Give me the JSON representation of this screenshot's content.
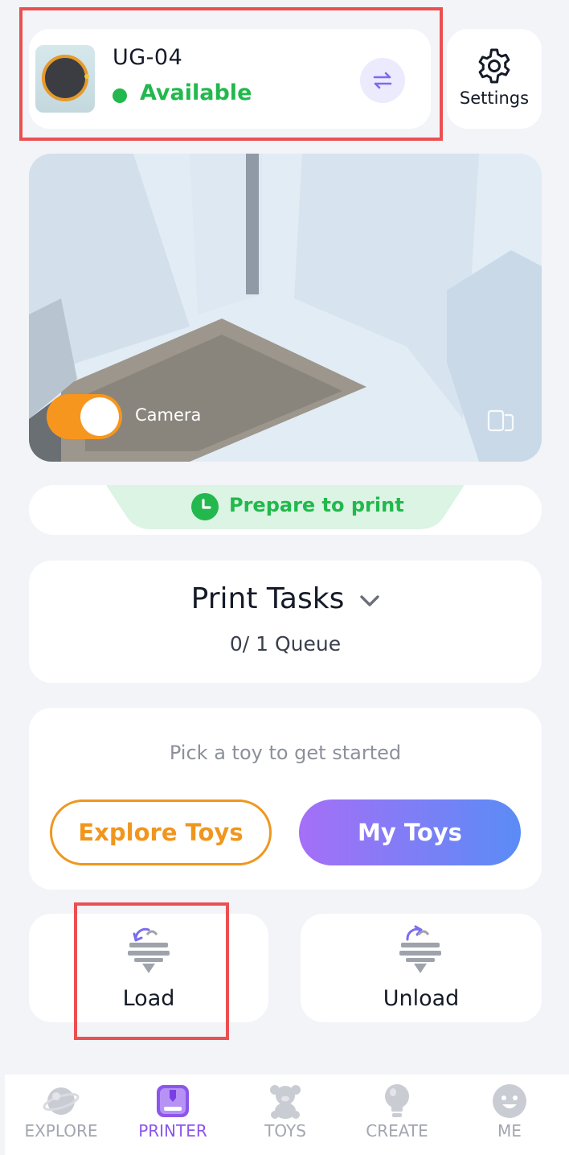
{
  "device": {
    "name": "UG-04",
    "status": "Available",
    "status_color": "#22b84d"
  },
  "settings": {
    "label": "Settings"
  },
  "camera": {
    "label": "Camera",
    "enabled": true,
    "toggle_color": "#f7961e"
  },
  "print_status": {
    "text": "Prepare to print"
  },
  "print_tasks": {
    "title": "Print Tasks",
    "queue": "0/ 1 Queue"
  },
  "toy_picker": {
    "prompt": "Pick a toy to get started",
    "explore_label": "Explore Toys",
    "mytoys_label": "My Toys"
  },
  "filament": {
    "load_label": "Load",
    "unload_label": "Unload"
  },
  "nav": {
    "items": [
      {
        "label": "EXPLORE",
        "icon": "planet-icon",
        "active": false
      },
      {
        "label": "PRINTER",
        "icon": "printer-icon",
        "active": true
      },
      {
        "label": "TOYS",
        "icon": "teddy-bear-icon",
        "active": false
      },
      {
        "label": "CREATE",
        "icon": "lightbulb-icon",
        "active": false
      },
      {
        "label": "ME",
        "icon": "smiley-face-icon",
        "active": false
      }
    ]
  },
  "colors": {
    "accent_orange": "#f0961e",
    "accent_purple": "#8c56ec",
    "gradient_start": "#a56ff6",
    "gradient_end": "#5a8cf6",
    "highlight_red": "#ec4f51"
  }
}
